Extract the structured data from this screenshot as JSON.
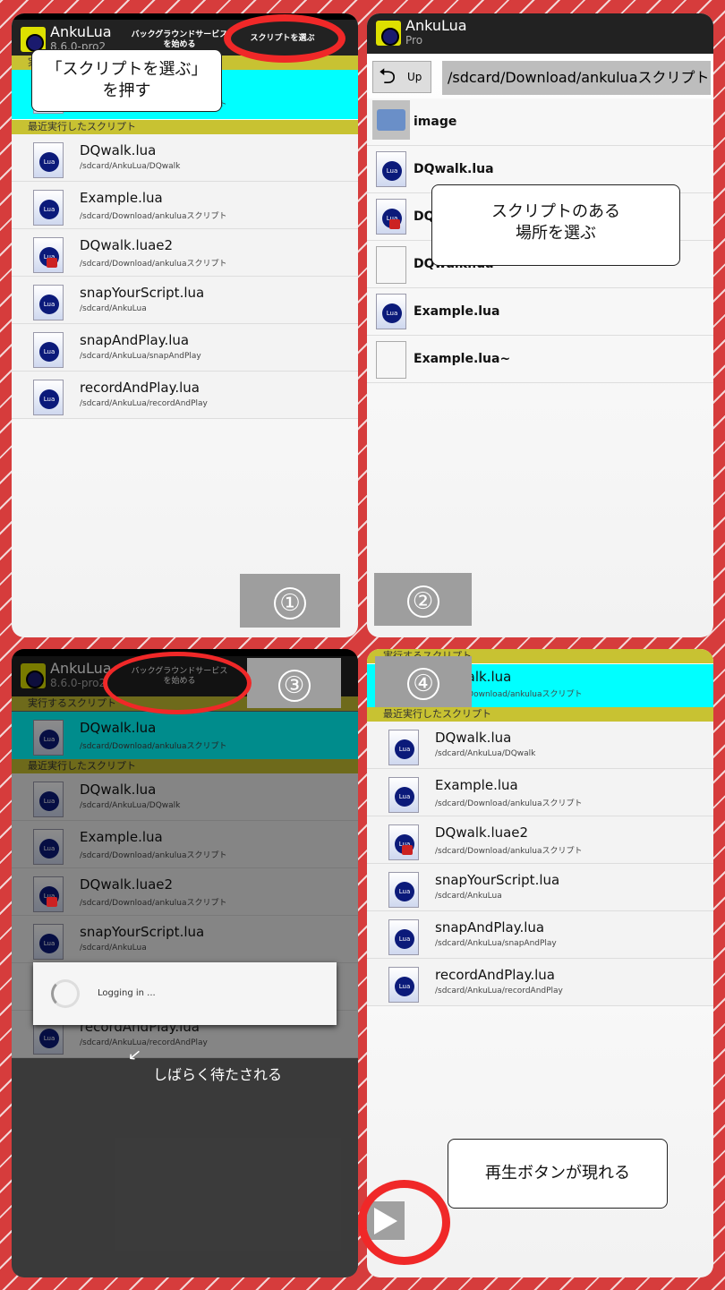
{
  "app": {
    "name": "AnkuLua",
    "version": "8.6.0-pro2",
    "edition": "Pro"
  },
  "header": {
    "start_service": "バックグラウンドサービス\nを始める",
    "choose_script": "スクリプトを選ぶ"
  },
  "sections": {
    "run_script": "実行するスクリプト",
    "recent": "最近実行したスクリプト"
  },
  "current": {
    "name": "DQwalk.lua",
    "path": "/sdcard/Download/ankuluaスクリプト"
  },
  "recent": [
    {
      "name": "DQwalk.lua",
      "path": "/sdcard/AnkuLua/DQwalk",
      "lock": false
    },
    {
      "name": "Example.lua",
      "path": "/sdcard/Download/ankuluaスクリプト",
      "lock": false
    },
    {
      "name": "DQwalk.luae2",
      "path": "/sdcard/Download/ankuluaスクリプト",
      "lock": true
    },
    {
      "name": "snapYourScript.lua",
      "path": "/sdcard/AnkuLua",
      "lock": false
    },
    {
      "name": "snapAndPlay.lua",
      "path": "/sdcard/AnkuLua/snapAndPlay",
      "lock": false
    },
    {
      "name": "recordAndPlay.lua",
      "path": "/sdcard/AnkuLua/recordAndPlay",
      "lock": false
    }
  ],
  "browser": {
    "up_label": "Up",
    "path": "/sdcard/Download/ankuluaスクリプト",
    "items": [
      {
        "name": "image",
        "type": "folder"
      },
      {
        "name": "DQwalk.lua",
        "type": "lua"
      },
      {
        "name": "DQwalk.luae2",
        "type": "lock"
      },
      {
        "name": "DQwalk.lua~",
        "type": "plain"
      },
      {
        "name": "Example.lua",
        "type": "lua"
      },
      {
        "name": "Example.lua~",
        "type": "plain"
      }
    ]
  },
  "dialog": {
    "text": "Logging in ..."
  },
  "annotations": {
    "step1": "「スクリプトを選ぶ」\nを押す",
    "step2": "スクリプトのある\n場所を選ぶ",
    "step3": "しばらく待たされる",
    "step4": "再生ボタンが現れる"
  },
  "steps": [
    "①",
    "②",
    "③",
    "④"
  ]
}
